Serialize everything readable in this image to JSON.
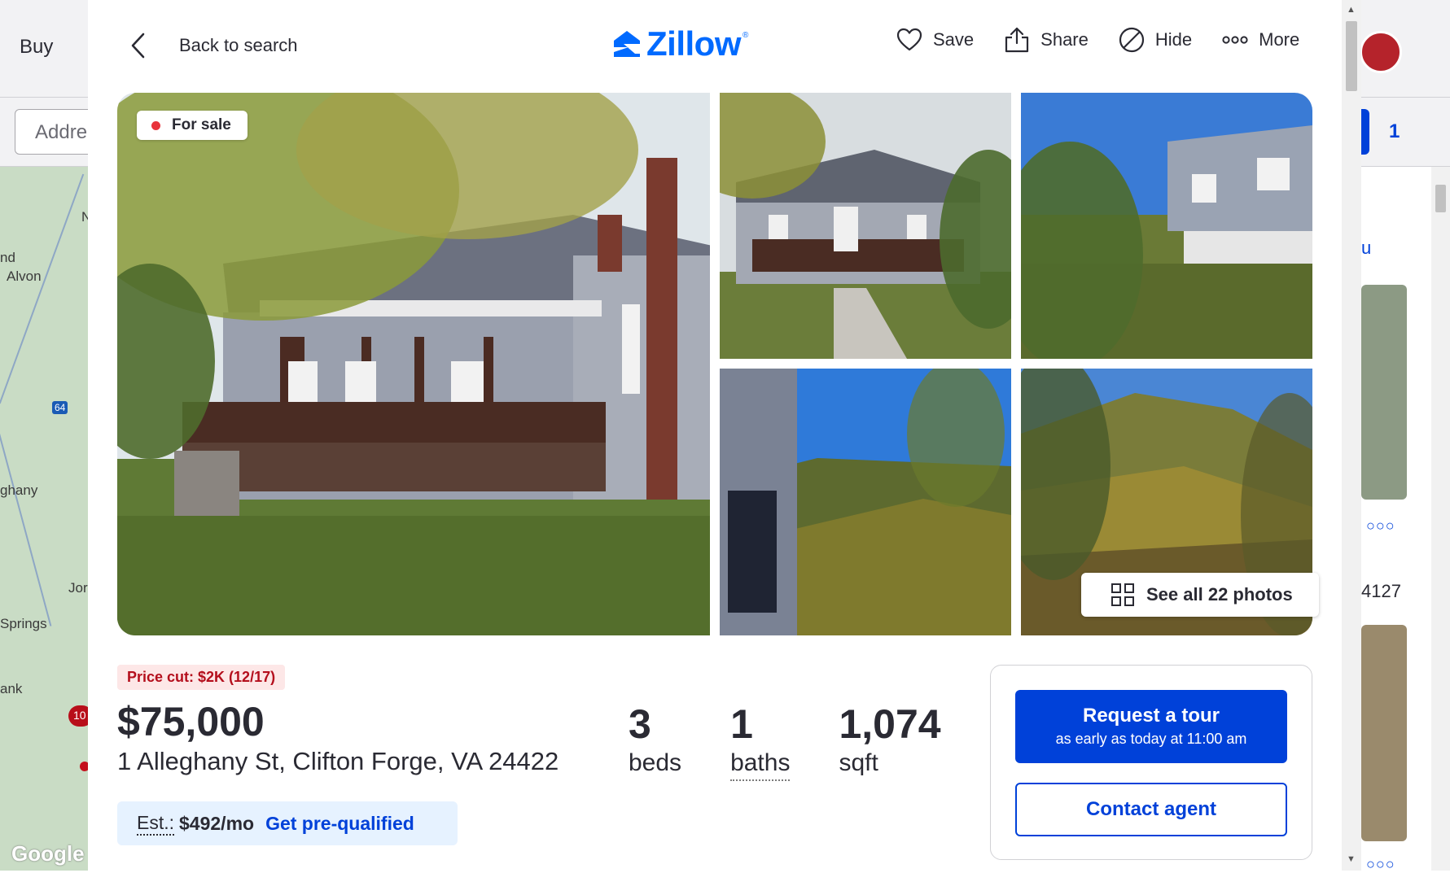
{
  "background": {
    "nav_buy": "Buy",
    "address_placeholder": "Addre",
    "saved_count": "1",
    "map_labels": [
      "nd",
      "Alvon",
      "N",
      "64",
      "ghany",
      "Jor",
      "Springs",
      "ank",
      "10"
    ],
    "map_credit": "Google",
    "side_number": "4127",
    "side_chevron_text": "u"
  },
  "header": {
    "back_label": "Back to search",
    "logo_text": "Zillow",
    "actions": {
      "save": "Save",
      "share": "Share",
      "hide": "Hide",
      "more": "More"
    }
  },
  "gallery": {
    "status": "For sale",
    "see_all": "See all 22 photos"
  },
  "listing": {
    "price_cut": "Price cut: $2K (12/17)",
    "price": "$75,000",
    "address": "1 Alleghany St, Clifton Forge, VA 24422",
    "beds_value": "3",
    "beds_label": "beds",
    "baths_value": "1",
    "baths_label": "baths",
    "sqft_value": "1,074",
    "sqft_label": "sqft",
    "est_label": "Est.:",
    "est_value": "$492/mo",
    "est_link": "Get pre-qualified"
  },
  "cta": {
    "tour_title": "Request a tour",
    "tour_sub": "as early as today at 11:00 am",
    "contact": "Contact agent"
  },
  "colors": {
    "brand_blue": "#006aff",
    "action_blue": "#0041d9",
    "status_red": "#e8333b",
    "price_cut_text": "#b40e1c",
    "price_cut_bg": "#fde7e7"
  }
}
